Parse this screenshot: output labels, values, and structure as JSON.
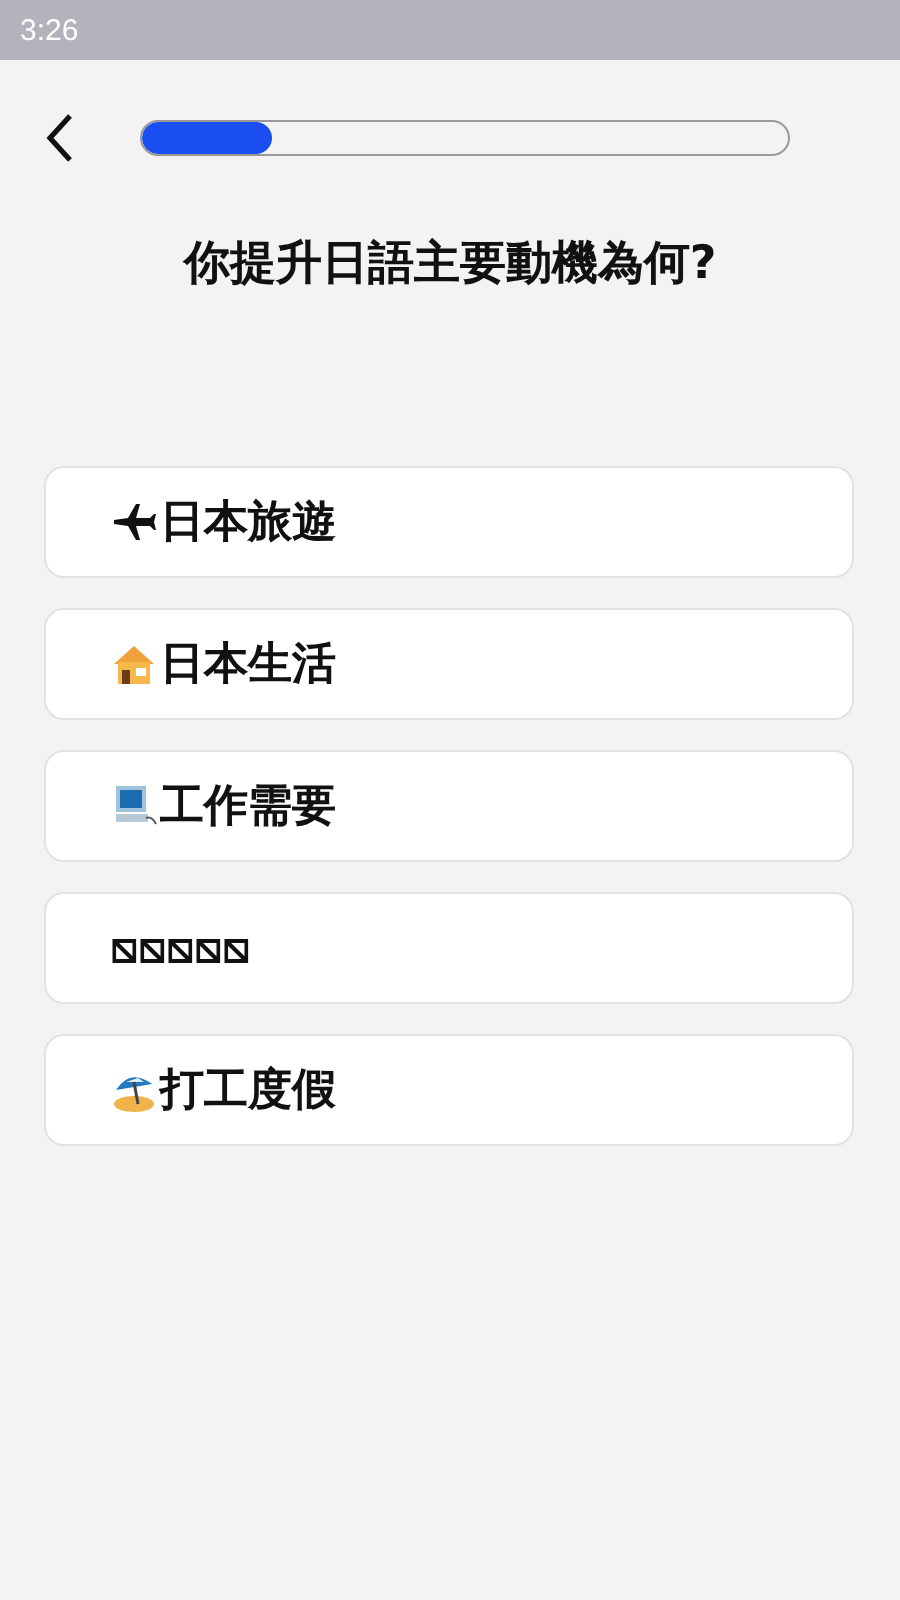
{
  "status_bar": {
    "time": "3:26"
  },
  "progress": {
    "level": 0.2
  },
  "question": "你提升日語主要動機為何?",
  "options": [
    {
      "kind": "plane",
      "label": "日本旅遊"
    },
    {
      "kind": "house",
      "label": "日本生活"
    },
    {
      "kind": "computer",
      "label": "工作需要"
    },
    {
      "kind": "plain",
      "label": "⧅⧅⧅⧅⧅"
    },
    {
      "kind": "beach",
      "label": "打工度假"
    }
  ]
}
